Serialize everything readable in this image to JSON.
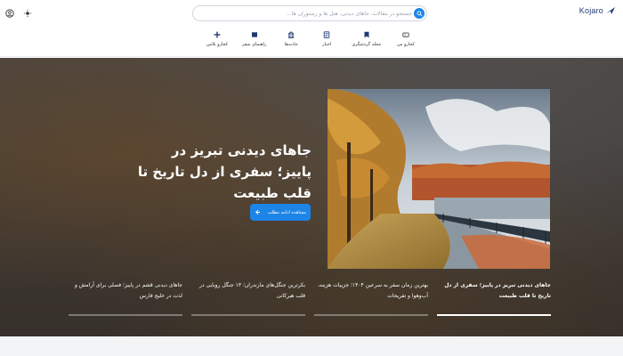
{
  "header": {
    "logo_text": "Kojaro",
    "search": {
      "placeholder": "جستجو در مقالات، جاهای دیدنی، هتل ها و رستوران ها..."
    },
    "utility_icons": [
      "user-circle-icon",
      "settings-sun-icon"
    ],
    "nav": [
      {
        "label": "کجارو من",
        "icon": "ticket-icon"
      },
      {
        "label": "مجله گردشگری",
        "icon": "bookmark-icon"
      },
      {
        "label": "اخبار",
        "icon": "news-icon"
      },
      {
        "label": "جاذبه‌ها",
        "icon": "tower-icon"
      },
      {
        "label": "راهنمای سفر",
        "icon": "guide-icon"
      },
      {
        "label": "کجارو پلاس",
        "icon": "plus-icon"
      }
    ]
  },
  "hero": {
    "title": "جاهای دیدنی تبریز در پاییز؛ سفری از دل تاریخ تا قلب طبیعت",
    "button_label": "مشاهده ادامه مطلب",
    "cards": [
      {
        "title": "جاهای دیدنی تبریز در پاییز؛ سفری از دل تاریخ تا قلب طبیعت",
        "active": true
      },
      {
        "title": "بهترین زمان سفر به سرعین ۱۴۰۴؛ جزییات هزینه، آب‌وهوا و تفریحات",
        "active": false
      },
      {
        "title": "بکرترین جنگل‌های مازندران؛ ۱۳ جنگل رویایی در قلب هیرکانی",
        "active": false
      },
      {
        "title": "جاهای دیدنی قشم در پاییز؛ فصلی برای آرامش و لذت در خلیج فارس",
        "active": false
      }
    ]
  },
  "colors": {
    "accent": "#1d84e8",
    "logo": "#1f3b73"
  }
}
